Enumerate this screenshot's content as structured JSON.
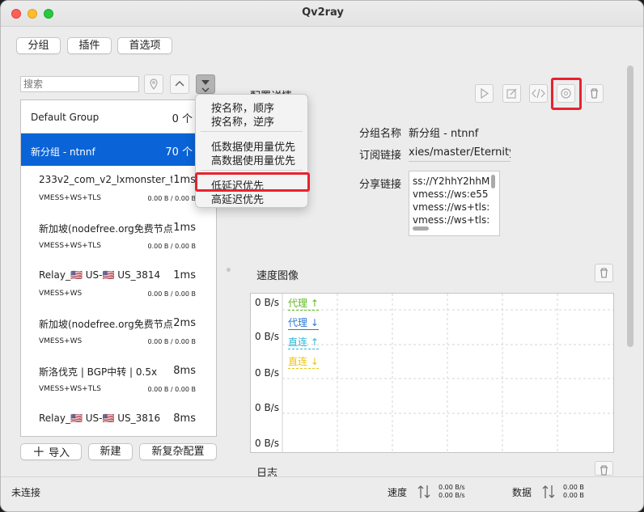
{
  "window": {
    "title": "Qv2ray"
  },
  "toolbar": {
    "groups": "分组",
    "plugins": "插件",
    "preferences": "首选项"
  },
  "search": {
    "placeholder": "搜索"
  },
  "groups": [
    {
      "name": "Default Group",
      "count": "0 个"
    },
    {
      "name": "新分组 - ntnnf",
      "count": "70 个"
    }
  ],
  "nodes": [
    {
      "name": "233v2_com_v2_lxmonster_to",
      "latency": "1ms",
      "protocol": "VMESS+WS+TLS",
      "traffic": "0.00 B / 0.00 B"
    },
    {
      "name": "新加坡(nodefree.org免费节点每",
      "latency": "1ms",
      "protocol": "VMESS+WS+TLS",
      "traffic": "0.00 B / 0.00 B"
    },
    {
      "name": "Relay_🇺🇸 US-🇺🇸 US_3814",
      "latency": "1ms",
      "protocol": "VMESS+WS",
      "traffic": "0.00 B / 0.00 B"
    },
    {
      "name": "新加坡(nodefree.org免费节点每",
      "latency": "2ms",
      "protocol": "VMESS+WS",
      "traffic": "0.00 B / 0.00 B"
    },
    {
      "name": "斯洛伐克 | BGP中转 | 0.5x",
      "latency": "8ms",
      "protocol": "VMESS+WS+TLS",
      "traffic": "0.00 B / 0.00 B"
    },
    {
      "name": "Relay_🇺🇸 US-🇺🇸 US_3816",
      "latency": "8ms",
      "protocol": "",
      "traffic": ""
    }
  ],
  "sort_menu": {
    "items": [
      "按名称，顺序",
      "按名称，逆序",
      "低数据使用量优先",
      "高数据使用量优先",
      "低延迟优先",
      "高延迟优先"
    ],
    "highlighted": "低延迟优先"
  },
  "bottom_buttons": {
    "import": "导入",
    "new": "新建",
    "new_complex": "新复杂配置"
  },
  "details": {
    "title": "配置详情",
    "group_name_label": "分组名称",
    "group_name_value": "新分组 - ntnnf",
    "subscription_label": "订阅链接",
    "subscription_value": "xies/master/Eternity",
    "share_label": "分享链接",
    "share_lines": [
      "ss://Y2hhY2hhM",
      "vmess://ws:e55",
      "vmess://ws+tls:",
      "vmess://ws+tls:"
    ]
  },
  "speed_chart": {
    "title": "速度图像",
    "y_labels": [
      "0 B/s",
      "0 B/s",
      "0 B/s",
      "0 B/s",
      "0 B/s"
    ],
    "legend": [
      {
        "label": "代理 ↑",
        "color": "#5fb81f"
      },
      {
        "label": "代理 ↓",
        "color": "#2a79d4"
      },
      {
        "label": "直连 ↑",
        "color": "#2bb6d8"
      },
      {
        "label": "直连 ↓",
        "color": "#e8c418"
      }
    ]
  },
  "log": {
    "title": "日志"
  },
  "status": {
    "connection": "未连接",
    "speed_label": "速度",
    "speed_up": "0.00 B/s",
    "speed_down": "0.00 B/s",
    "data_label": "数据",
    "data_up": "0.00 B",
    "data_down": "0.00 B"
  },
  "colors": {
    "accent": "#0a64d7",
    "highlight_box": "#e8222e"
  }
}
